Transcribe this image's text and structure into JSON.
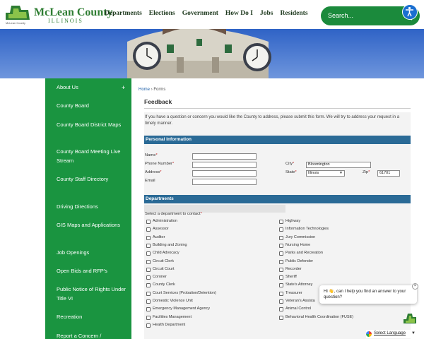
{
  "header": {
    "logo_name": "McLean County",
    "logo_state": "ILLINOIS",
    "logo_tagline": "McLean County",
    "nav": [
      "Departments",
      "Elections",
      "Government",
      "How Do I",
      "Jobs",
      "Residents"
    ],
    "search_placeholder": "Search..."
  },
  "sidebar": {
    "items": [
      "About Us",
      "County Board",
      "County Board District Maps",
      "County Board Meeting Live Stream",
      "County Staff Directory",
      "Driving Directions",
      "GIS Maps and Applications",
      "Job Openings",
      "Open Bids and RFP's",
      "Public Notice of Rights Under Title VI",
      "Recreation",
      "Report a Concern /"
    ],
    "expand_symbol": "+"
  },
  "breadcrumb": {
    "home": "Home",
    "sep": "›",
    "current": "Forms"
  },
  "page": {
    "title": "Feedback",
    "intro": "If you have a question or concern you would like the County to address, please submit this form. We will try to address your request in a timely manner."
  },
  "personal": {
    "heading": "Personal Information",
    "name_label": "Name",
    "phone_label": "Phone Number",
    "address_label": "Address",
    "email_label": "Email",
    "city_label": "City",
    "city_value": "Bloomington",
    "state_label": "State",
    "state_value": "Illinois",
    "zip_label": "Zip",
    "zip_value": "61701",
    "required_mark": "*"
  },
  "departments": {
    "heading": "Departments",
    "prompt": "Select a department to contact",
    "left": [
      "Administration",
      "Assessor",
      "Auditor",
      "Building and Zoning",
      "Child Advocacy",
      "Circuit Clerk",
      "Circuit Court",
      "Coroner",
      "County Clerk",
      "Court Services (Probation/Detention)",
      "Domestic Violence Unit",
      "Emergency Management Agency",
      "Facilities Management",
      "Health Department"
    ],
    "right": [
      "Highway",
      "Information Technologies",
      "Jury Commission",
      "Nursing Home",
      "Parks and Recreation",
      "Public Defender",
      "Recorder",
      "Sheriff",
      "State's Attorney",
      "Treasurer",
      "Veteran's Assista",
      "Animal Control",
      "Behavioral Health Coordination (FUSE)"
    ]
  },
  "chat": {
    "message": "Hi 👋, can I help you find an answer to your question?",
    "close": "×"
  },
  "translate": {
    "label": "Select Language",
    "caret": "▼"
  },
  "colors": {
    "brand_green": "#1a9440",
    "section_blue": "#2a6a96",
    "required_red": "#c62828"
  }
}
